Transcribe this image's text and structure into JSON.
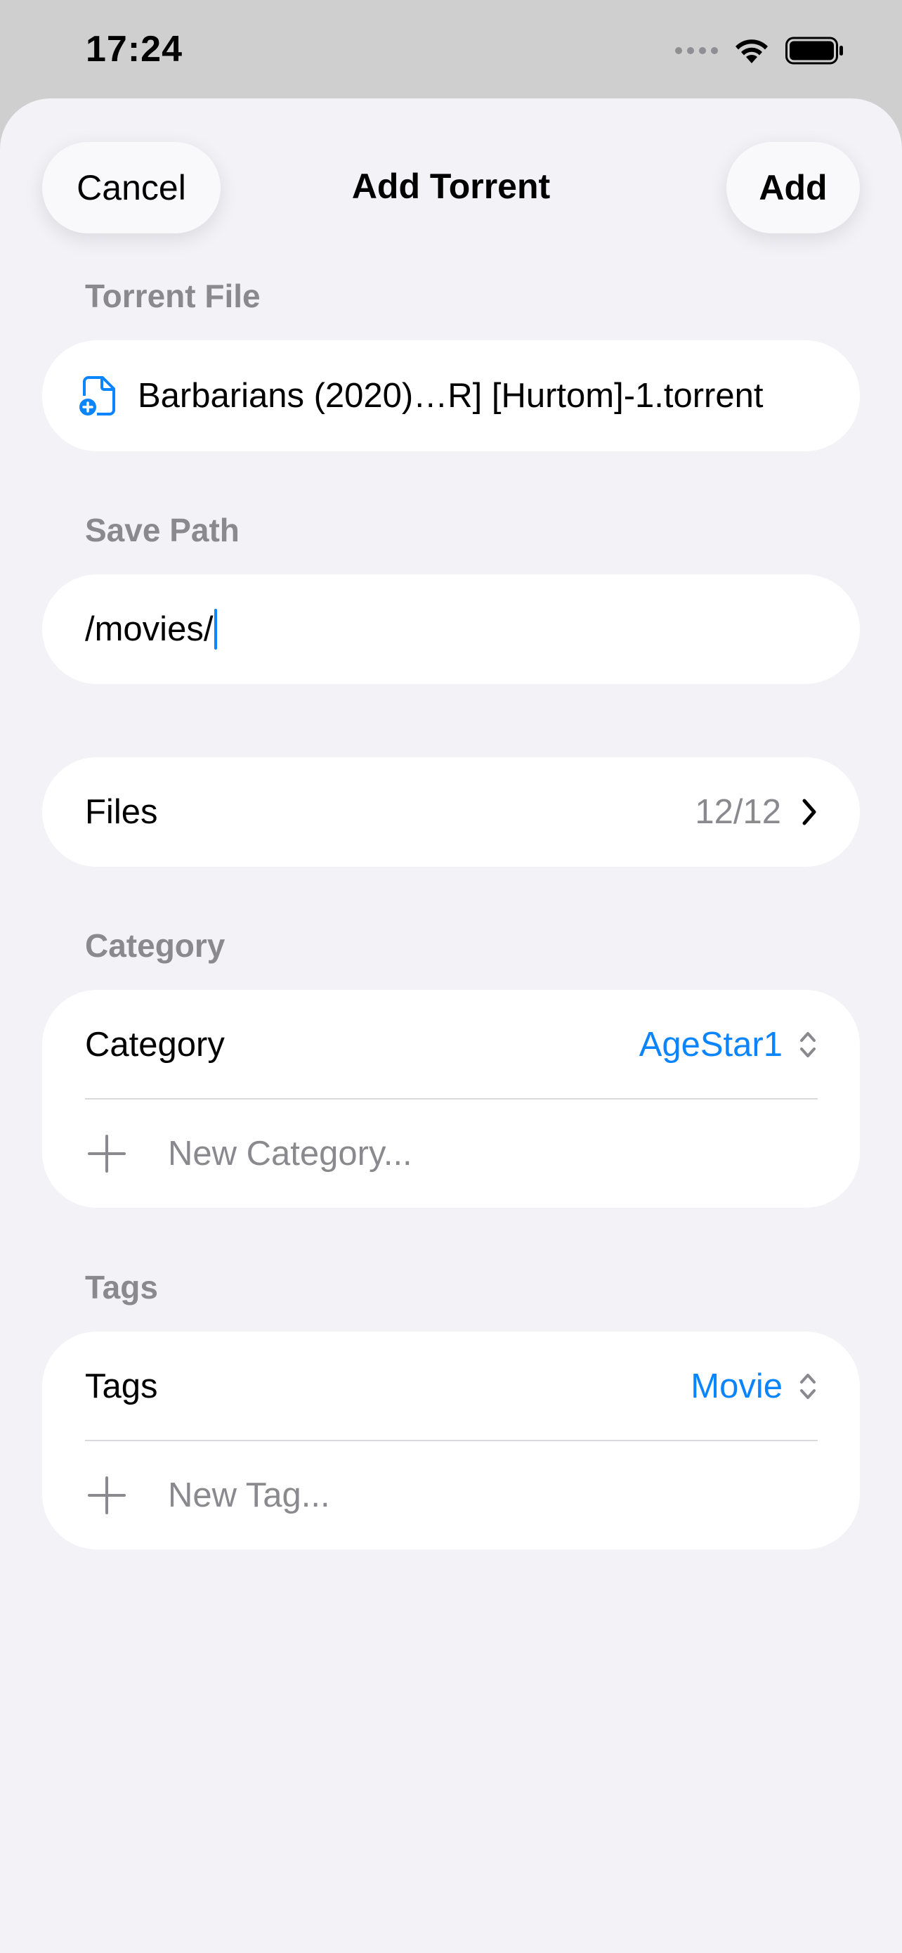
{
  "status_bar": {
    "time": "17:24"
  },
  "nav": {
    "cancel_label": "Cancel",
    "title": "Add Torrent",
    "add_label": "Add"
  },
  "torrent_file": {
    "header": "Torrent File",
    "filename": "Barbarians (2020)…R] [Hurtom]-1.torrent",
    "icon": "doc-badge-plus-icon"
  },
  "save_path": {
    "header": "Save Path",
    "value": "/movies/"
  },
  "files": {
    "label": "Files",
    "count": "12/12"
  },
  "category": {
    "header": "Category",
    "label": "Category",
    "selected": "AgeStar1",
    "new_placeholder": "New Category..."
  },
  "tags": {
    "header": "Tags",
    "label": "Tags",
    "selected": "Movie",
    "new_placeholder": "New Tag..."
  },
  "colors": {
    "accent": "#0a84ff",
    "background": "#f2f2f7",
    "card": "#ffffff",
    "secondary_text": "#8a8a8e"
  }
}
